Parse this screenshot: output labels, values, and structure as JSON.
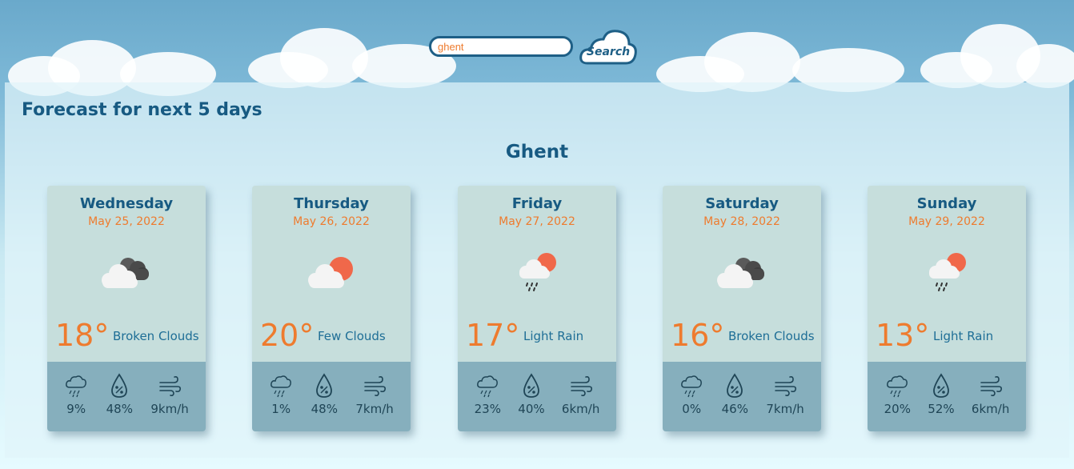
{
  "search": {
    "value": "ghent",
    "button_label": "Search"
  },
  "forecast": {
    "title": "Forecast for next 5 days",
    "city": "Ghent",
    "days": [
      {
        "day": "Wednesday",
        "date": "May 25, 2022",
        "icon": "broken-clouds-icon",
        "temp": "18°",
        "desc": "Broken Clouds",
        "precip": "9%",
        "humidity": "48%",
        "wind": "9km/h"
      },
      {
        "day": "Thursday",
        "date": "May 26, 2022",
        "icon": "few-clouds-icon",
        "temp": "20°",
        "desc": "Few Clouds",
        "precip": "1%",
        "humidity": "48%",
        "wind": "7km/h"
      },
      {
        "day": "Friday",
        "date": "May 27, 2022",
        "icon": "light-rain-icon",
        "temp": "17°",
        "desc": "Light Rain",
        "precip": "23%",
        "humidity": "40%",
        "wind": "6km/h"
      },
      {
        "day": "Saturday",
        "date": "May 28, 2022",
        "icon": "broken-clouds-icon",
        "temp": "16°",
        "desc": "Broken Clouds",
        "precip": "0%",
        "humidity": "46%",
        "wind": "7km/h"
      },
      {
        "day": "Sunday",
        "date": "May 29, 2022",
        "icon": "light-rain-icon",
        "temp": "13°",
        "desc": "Light Rain",
        "precip": "20%",
        "humidity": "52%",
        "wind": "6km/h"
      }
    ]
  },
  "colors": {
    "accent": "#ee7b2e",
    "primary": "#175a82",
    "card": "#c6dedc",
    "card_bottom": "#86afbd"
  }
}
